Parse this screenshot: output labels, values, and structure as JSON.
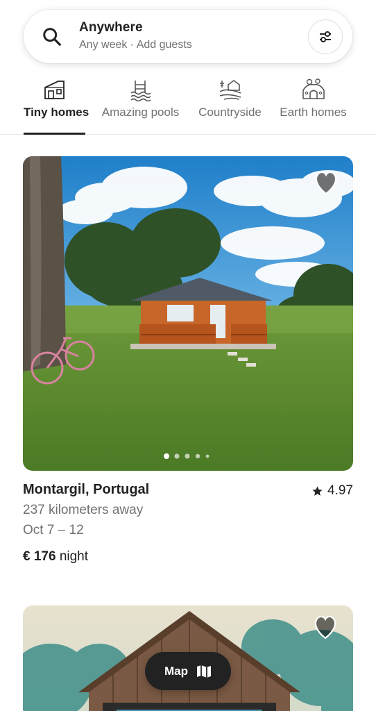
{
  "search": {
    "title": "Anywhere",
    "week": "Any week",
    "separator": "·",
    "guests": "Add guests"
  },
  "categories": [
    {
      "label": "Tiny homes",
      "icon": "tiny-home-icon",
      "active": true
    },
    {
      "label": "Amazing pools",
      "icon": "pool-icon",
      "active": false
    },
    {
      "label": "Countryside",
      "icon": "countryside-icon",
      "active": false
    },
    {
      "label": "Earth homes",
      "icon": "earth-home-icon",
      "active": false
    }
  ],
  "listings": [
    {
      "location": "Montargil, Portugal",
      "rating": "4.97",
      "distance": "237 kilometers away",
      "dates": "Oct 7 – 12",
      "price": "€ 176",
      "price_unit": "night",
      "photo_count_dots": 5,
      "active_dot": 0
    }
  ],
  "map_button": {
    "label": "Map"
  },
  "colors": {
    "text": "#222222",
    "muted": "#717171",
    "border": "#dddddd",
    "map_button_bg": "#222222"
  }
}
